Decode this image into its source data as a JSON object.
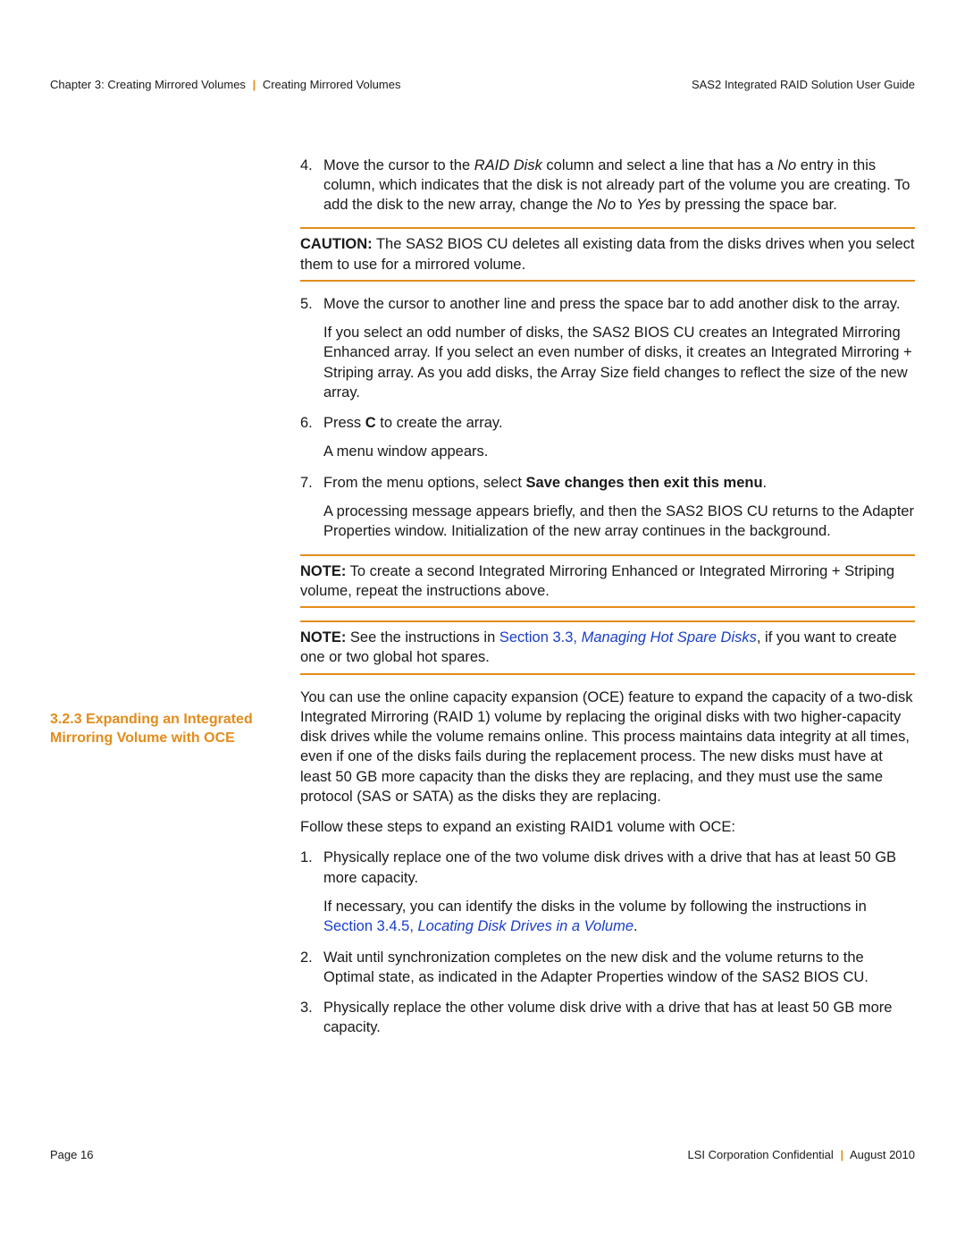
{
  "header": {
    "chapter": "Chapter 3: Creating Mirrored Volumes",
    "section": "Creating Mirrored Volumes",
    "doc_title": "SAS2 Integrated RAID Solution User Guide"
  },
  "section_title": "3.2.3  Expanding an Integrated Mirroring Volume with OCE",
  "list1": {
    "item4": {
      "num": "4.",
      "pre": "Move the cursor to the ",
      "ital1": "RAID Disk",
      "mid1": " column and select a line that has a ",
      "ital2": "No",
      "mid2": " entry in this column, which indicates that the disk is not already part of the volume you are creating. To add the disk to the new array, change the ",
      "ital3": "No",
      "mid3": " to ",
      "ital4": "Yes",
      "post": " by pressing the space bar."
    },
    "caution": {
      "label": "CAUTION:",
      "text": "  The SAS2 BIOS CU deletes all existing data from the disks drives when you select them to use for a mirrored volume."
    },
    "item5": {
      "num": "5.",
      "text": "Move the cursor to another line and press the space bar to add another disk to the array.",
      "sub": "If you select an odd number of disks, the SAS2 BIOS CU creates an Integrated Mirroring Enhanced array. If you select an even number of disks, it creates an Integrated Mirroring + Striping array. As you add disks, the Array Size field changes to reflect the size of the new array."
    },
    "item6": {
      "num": "6.",
      "pre": "Press ",
      "bold": "C",
      "post": " to create the array.",
      "sub": "A menu window appears."
    },
    "item7": {
      "num": "7.",
      "pre": "From the menu options, select ",
      "bold": "Save changes then exit this menu",
      "post": ".",
      "sub": "A processing message appears briefly, and then the SAS2 BIOS CU returns to the Adapter Properties window. Initialization of the new array continues in the background."
    },
    "note1": {
      "label": "NOTE:",
      "text": "  To create a second Integrated Mirroring Enhanced or Integrated Mirroring + Striping volume, repeat the instructions above."
    },
    "note2": {
      "label": "NOTE:",
      "pre": "  See the instructions in ",
      "link_sec": "Section 3.3",
      "link_sep": ", ",
      "link_title": "Managing Hot Spare Disks",
      "post": ", if you want to create one or two global hot spares."
    }
  },
  "oce": {
    "para": "You can use the online capacity expansion (OCE) feature to expand the capacity of a two-disk Integrated Mirroring (RAID 1) volume by replacing the original disks with two higher-capacity disk drives while the volume remains online. This process maintains data integrity at all times, even if one of the disks fails during the replacement process. The new disks must have at least 50 GB more capacity than the disks they are replacing, and they must use the same protocol (SAS or SATA) as the disks they are replacing.",
    "lead": "Follow these steps to expand an existing RAID1 volume with OCE:",
    "item1": {
      "num": "1.",
      "text": "Physically replace one of the two volume disk drives with a drive that has at least 50 GB more capacity.",
      "sub_pre": "If necessary, you can identify the disks in the volume by following the instructions in ",
      "sub_link_sec": "Section 3.4.5",
      "sub_link_sep": ", ",
      "sub_link_title": "Locating Disk Drives in a Volume",
      "sub_post": "."
    },
    "item2": {
      "num": "2.",
      "text": "Wait until synchronization completes on the new disk and the volume returns to the Optimal state, as indicated in the Adapter Properties window of the SAS2 BIOS CU."
    },
    "item3": {
      "num": "3.",
      "text": "Physically replace the other volume disk drive with a drive that has at least 50 GB more capacity."
    }
  },
  "footer": {
    "page": "Page 16",
    "conf": "LSI Corporation Confidential",
    "date": "August 2010"
  }
}
